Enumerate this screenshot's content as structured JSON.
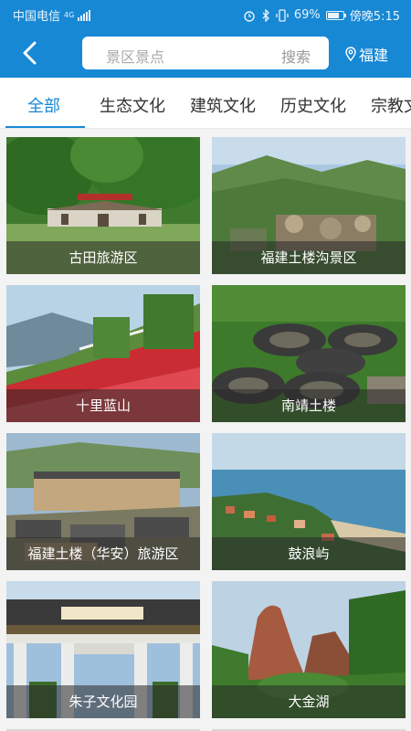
{
  "status_bar": {
    "carrier": "中国电信",
    "network": "4G",
    "battery": "69%",
    "battery_level": 0.69,
    "time": "傍晚5:15"
  },
  "header": {
    "search_placeholder": "景区景点",
    "search_button": "搜索",
    "location": "福建"
  },
  "tabs": [
    "全部",
    "生态文化",
    "建筑文化",
    "历史文化",
    "宗教文化"
  ],
  "active_tab": "全部",
  "spots": [
    {
      "name": "古田旅游区"
    },
    {
      "name": "福建土楼沟景区"
    },
    {
      "name": "十里蓝山"
    },
    {
      "name": "南靖土楼"
    },
    {
      "name": "福建土楼（华安）旅游区"
    },
    {
      "name": "鼓浪屿"
    },
    {
      "name": "朱子文化园"
    },
    {
      "name": "大金湖"
    }
  ],
  "colors": {
    "accent": "#1788d4",
    "caption_bg": "#282828"
  }
}
